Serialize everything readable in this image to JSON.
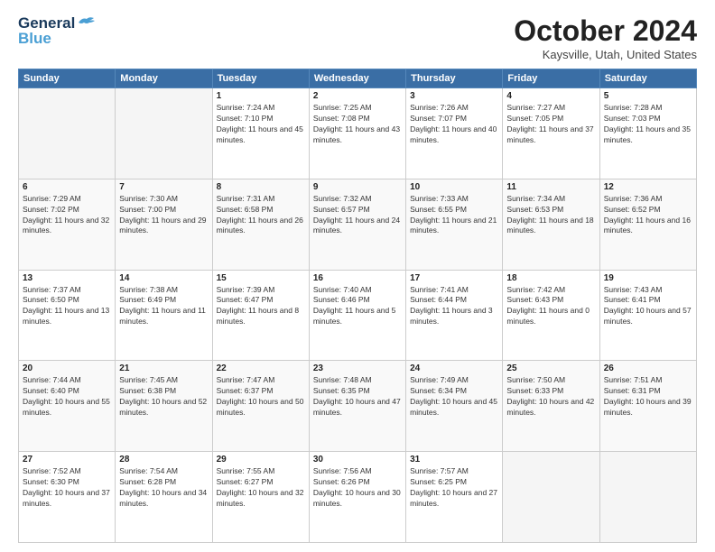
{
  "header": {
    "logo_line1": "General",
    "logo_line2": "Blue",
    "month": "October 2024",
    "location": "Kaysville, Utah, United States"
  },
  "weekdays": [
    "Sunday",
    "Monday",
    "Tuesday",
    "Wednesday",
    "Thursday",
    "Friday",
    "Saturday"
  ],
  "weeks": [
    [
      {
        "day": "",
        "sunrise": "",
        "sunset": "",
        "daylight": ""
      },
      {
        "day": "",
        "sunrise": "",
        "sunset": "",
        "daylight": ""
      },
      {
        "day": "1",
        "sunrise": "Sunrise: 7:24 AM",
        "sunset": "Sunset: 7:10 PM",
        "daylight": "Daylight: 11 hours and 45 minutes."
      },
      {
        "day": "2",
        "sunrise": "Sunrise: 7:25 AM",
        "sunset": "Sunset: 7:08 PM",
        "daylight": "Daylight: 11 hours and 43 minutes."
      },
      {
        "day": "3",
        "sunrise": "Sunrise: 7:26 AM",
        "sunset": "Sunset: 7:07 PM",
        "daylight": "Daylight: 11 hours and 40 minutes."
      },
      {
        "day": "4",
        "sunrise": "Sunrise: 7:27 AM",
        "sunset": "Sunset: 7:05 PM",
        "daylight": "Daylight: 11 hours and 37 minutes."
      },
      {
        "day": "5",
        "sunrise": "Sunrise: 7:28 AM",
        "sunset": "Sunset: 7:03 PM",
        "daylight": "Daylight: 11 hours and 35 minutes."
      }
    ],
    [
      {
        "day": "6",
        "sunrise": "Sunrise: 7:29 AM",
        "sunset": "Sunset: 7:02 PM",
        "daylight": "Daylight: 11 hours and 32 minutes."
      },
      {
        "day": "7",
        "sunrise": "Sunrise: 7:30 AM",
        "sunset": "Sunset: 7:00 PM",
        "daylight": "Daylight: 11 hours and 29 minutes."
      },
      {
        "day": "8",
        "sunrise": "Sunrise: 7:31 AM",
        "sunset": "Sunset: 6:58 PM",
        "daylight": "Daylight: 11 hours and 26 minutes."
      },
      {
        "day": "9",
        "sunrise": "Sunrise: 7:32 AM",
        "sunset": "Sunset: 6:57 PM",
        "daylight": "Daylight: 11 hours and 24 minutes."
      },
      {
        "day": "10",
        "sunrise": "Sunrise: 7:33 AM",
        "sunset": "Sunset: 6:55 PM",
        "daylight": "Daylight: 11 hours and 21 minutes."
      },
      {
        "day": "11",
        "sunrise": "Sunrise: 7:34 AM",
        "sunset": "Sunset: 6:53 PM",
        "daylight": "Daylight: 11 hours and 18 minutes."
      },
      {
        "day": "12",
        "sunrise": "Sunrise: 7:36 AM",
        "sunset": "Sunset: 6:52 PM",
        "daylight": "Daylight: 11 hours and 16 minutes."
      }
    ],
    [
      {
        "day": "13",
        "sunrise": "Sunrise: 7:37 AM",
        "sunset": "Sunset: 6:50 PM",
        "daylight": "Daylight: 11 hours and 13 minutes."
      },
      {
        "day": "14",
        "sunrise": "Sunrise: 7:38 AM",
        "sunset": "Sunset: 6:49 PM",
        "daylight": "Daylight: 11 hours and 11 minutes."
      },
      {
        "day": "15",
        "sunrise": "Sunrise: 7:39 AM",
        "sunset": "Sunset: 6:47 PM",
        "daylight": "Daylight: 11 hours and 8 minutes."
      },
      {
        "day": "16",
        "sunrise": "Sunrise: 7:40 AM",
        "sunset": "Sunset: 6:46 PM",
        "daylight": "Daylight: 11 hours and 5 minutes."
      },
      {
        "day": "17",
        "sunrise": "Sunrise: 7:41 AM",
        "sunset": "Sunset: 6:44 PM",
        "daylight": "Daylight: 11 hours and 3 minutes."
      },
      {
        "day": "18",
        "sunrise": "Sunrise: 7:42 AM",
        "sunset": "Sunset: 6:43 PM",
        "daylight": "Daylight: 11 hours and 0 minutes."
      },
      {
        "day": "19",
        "sunrise": "Sunrise: 7:43 AM",
        "sunset": "Sunset: 6:41 PM",
        "daylight": "Daylight: 10 hours and 57 minutes."
      }
    ],
    [
      {
        "day": "20",
        "sunrise": "Sunrise: 7:44 AM",
        "sunset": "Sunset: 6:40 PM",
        "daylight": "Daylight: 10 hours and 55 minutes."
      },
      {
        "day": "21",
        "sunrise": "Sunrise: 7:45 AM",
        "sunset": "Sunset: 6:38 PM",
        "daylight": "Daylight: 10 hours and 52 minutes."
      },
      {
        "day": "22",
        "sunrise": "Sunrise: 7:47 AM",
        "sunset": "Sunset: 6:37 PM",
        "daylight": "Daylight: 10 hours and 50 minutes."
      },
      {
        "day": "23",
        "sunrise": "Sunrise: 7:48 AM",
        "sunset": "Sunset: 6:35 PM",
        "daylight": "Daylight: 10 hours and 47 minutes."
      },
      {
        "day": "24",
        "sunrise": "Sunrise: 7:49 AM",
        "sunset": "Sunset: 6:34 PM",
        "daylight": "Daylight: 10 hours and 45 minutes."
      },
      {
        "day": "25",
        "sunrise": "Sunrise: 7:50 AM",
        "sunset": "Sunset: 6:33 PM",
        "daylight": "Daylight: 10 hours and 42 minutes."
      },
      {
        "day": "26",
        "sunrise": "Sunrise: 7:51 AM",
        "sunset": "Sunset: 6:31 PM",
        "daylight": "Daylight: 10 hours and 39 minutes."
      }
    ],
    [
      {
        "day": "27",
        "sunrise": "Sunrise: 7:52 AM",
        "sunset": "Sunset: 6:30 PM",
        "daylight": "Daylight: 10 hours and 37 minutes."
      },
      {
        "day": "28",
        "sunrise": "Sunrise: 7:54 AM",
        "sunset": "Sunset: 6:28 PM",
        "daylight": "Daylight: 10 hours and 34 minutes."
      },
      {
        "day": "29",
        "sunrise": "Sunrise: 7:55 AM",
        "sunset": "Sunset: 6:27 PM",
        "daylight": "Daylight: 10 hours and 32 minutes."
      },
      {
        "day": "30",
        "sunrise": "Sunrise: 7:56 AM",
        "sunset": "Sunset: 6:26 PM",
        "daylight": "Daylight: 10 hours and 30 minutes."
      },
      {
        "day": "31",
        "sunrise": "Sunrise: 7:57 AM",
        "sunset": "Sunset: 6:25 PM",
        "daylight": "Daylight: 10 hours and 27 minutes."
      },
      {
        "day": "",
        "sunrise": "",
        "sunset": "",
        "daylight": ""
      },
      {
        "day": "",
        "sunrise": "",
        "sunset": "",
        "daylight": ""
      }
    ]
  ]
}
